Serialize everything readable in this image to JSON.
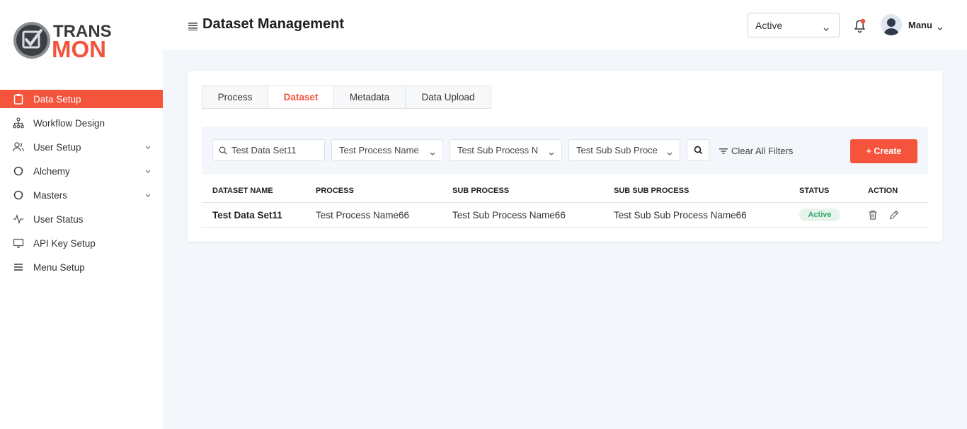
{
  "brand": {
    "logo_top": "TRANS",
    "logo_bottom": "MON",
    "accent": "#f4533c"
  },
  "sidebar": {
    "items": [
      {
        "label": "Data Setup",
        "icon": "clipboard-icon",
        "active": true
      },
      {
        "label": "Workflow Design",
        "icon": "hierarchy-icon"
      },
      {
        "label": "User Setup",
        "icon": "users-icon",
        "expandable": true
      },
      {
        "label": "Alchemy",
        "icon": "circle-icon",
        "expandable": true
      },
      {
        "label": "Masters",
        "icon": "circle-icon",
        "expandable": true
      },
      {
        "label": "User Status",
        "icon": "activity-icon"
      },
      {
        "label": "API Key Setup",
        "icon": "monitor-icon"
      },
      {
        "label": "Menu Setup",
        "icon": "list-icon"
      }
    ]
  },
  "header": {
    "title": "Dataset Management",
    "status_select": "Active",
    "user_name": "Manu"
  },
  "tabs": [
    {
      "label": "Process"
    },
    {
      "label": "Dataset",
      "active": true
    },
    {
      "label": "Metadata"
    },
    {
      "label": "Data Upload"
    }
  ],
  "filters": {
    "search_value": "Test Data Set11",
    "process": "Test Process Name",
    "sub_process": "Test Sub Process N",
    "sub_sub_process": "Test Sub Sub Proce",
    "clear_label": "Clear All Filters",
    "create_label": "+ Create"
  },
  "table": {
    "columns": [
      "DATASET NAME",
      "PROCESS",
      "SUB PROCESS",
      "SUB SUB PROCESS",
      "STATUS",
      "ACTION"
    ],
    "rows": [
      {
        "dataset_name": "Test Data Set11",
        "process": "Test Process Name66",
        "sub_process": "Test Sub Process Name66",
        "sub_sub_process": "Test Sub Sub Process Name66",
        "status": "Active"
      }
    ]
  }
}
